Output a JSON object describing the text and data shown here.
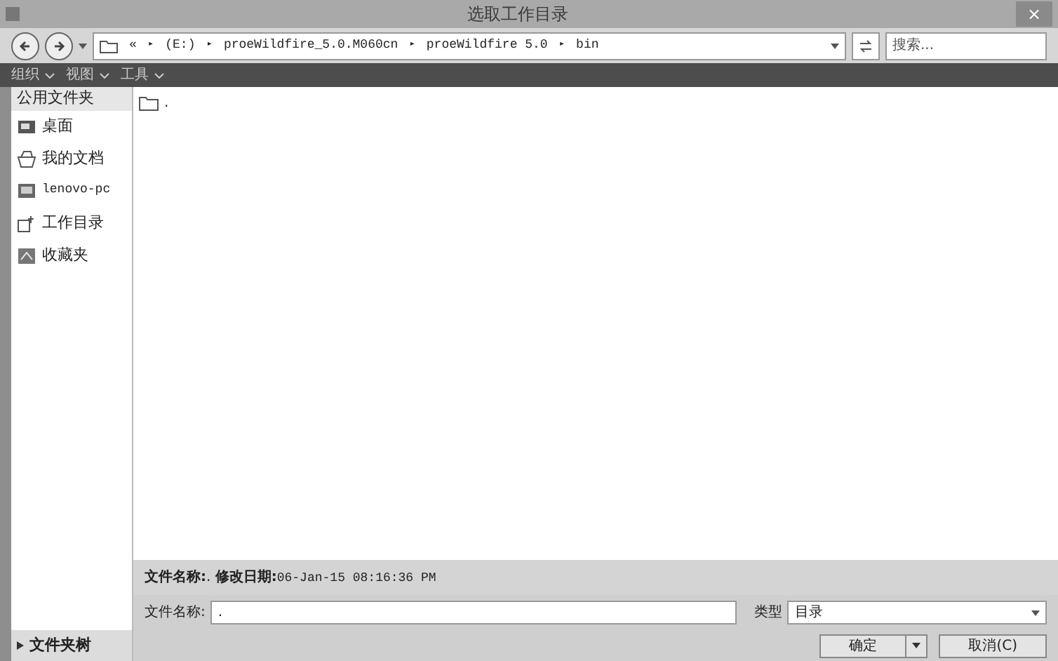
{
  "window": {
    "title": "选取工作目录",
    "close": "×"
  },
  "address": {
    "prefix": "«",
    "crumbs": [
      "(E:)",
      "proeWildfire_5.0.M060cn",
      "proeWildfire 5.0",
      "bin"
    ],
    "separator": "▸"
  },
  "search": {
    "placeholder": "搜索..."
  },
  "toolbar": [
    "组织",
    "视图",
    "工具"
  ],
  "sidebar": {
    "header": "公用文件夹",
    "items": [
      {
        "label": "桌面",
        "kind": "desktop"
      },
      {
        "label": "我的文档",
        "kind": "docs"
      },
      {
        "label": "lenovo-pc",
        "kind": "pc"
      },
      {
        "label": "工作目录",
        "kind": "workdir"
      },
      {
        "label": "收藏夹",
        "kind": "favorites"
      }
    ],
    "footer": "文件夹树"
  },
  "files": [
    {
      "label": "."
    }
  ],
  "info": {
    "name_label": "文件名称:",
    "name": ".",
    "date_label": "修改日期:",
    "date": "06-Jan-15 08:16:36 PM"
  },
  "filename": {
    "label": "文件名称:",
    "value": "."
  },
  "type": {
    "label": "类型",
    "value": "目录"
  },
  "buttons": [
    {
      "label": "确定",
      "kind": "split"
    },
    {
      "label": "取消(C)",
      "kind": "plain"
    }
  ]
}
